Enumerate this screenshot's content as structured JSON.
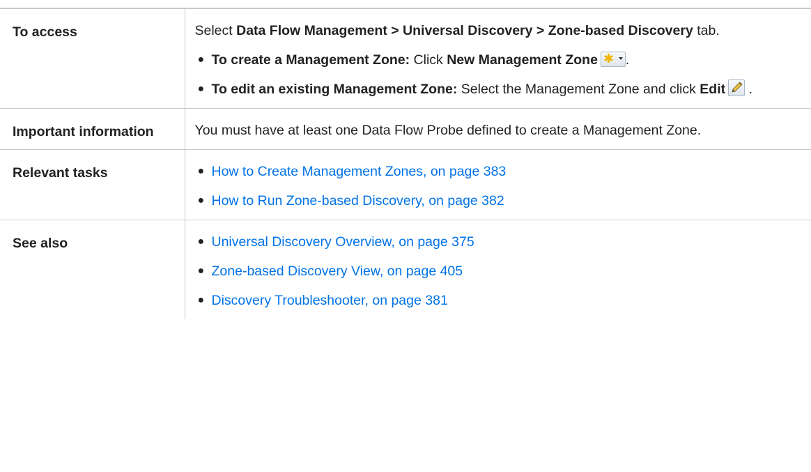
{
  "rows": {
    "access": {
      "label": "To access",
      "intro": {
        "t1": "Select ",
        "b1": "Data Flow Management > Universal Discovery > Zone-based Discovery",
        "t2": " tab."
      },
      "create": {
        "bold": "To create a Management Zone:",
        "text": " Click ",
        "bold2": "New Management Zone",
        "end": ".",
        "icon": "new-star-dropdown-icon"
      },
      "edit": {
        "bold": "To edit an existing Management Zone:",
        "text": " Select the Management Zone and click ",
        "bold2": "Edit",
        "end": ".",
        "icon": "pencil-edit-icon"
      }
    },
    "important": {
      "label": "Important information",
      "text": "You must have at least one Data Flow Probe defined to create a Management Zone."
    },
    "tasks": {
      "label": "Relevant tasks",
      "links": [
        "How to Create Management Zones, on page 383",
        "How to Run Zone-based Discovery, on page 382"
      ]
    },
    "see_also": {
      "label": "See also",
      "links": [
        "Universal Discovery Overview, on page 375",
        "Zone-based Discovery View, on page 405",
        "Discovery Troubleshooter, on page 381"
      ]
    }
  },
  "colors": {
    "link": "#0073e7",
    "border": "#c8c8c8",
    "text": "#222222"
  }
}
